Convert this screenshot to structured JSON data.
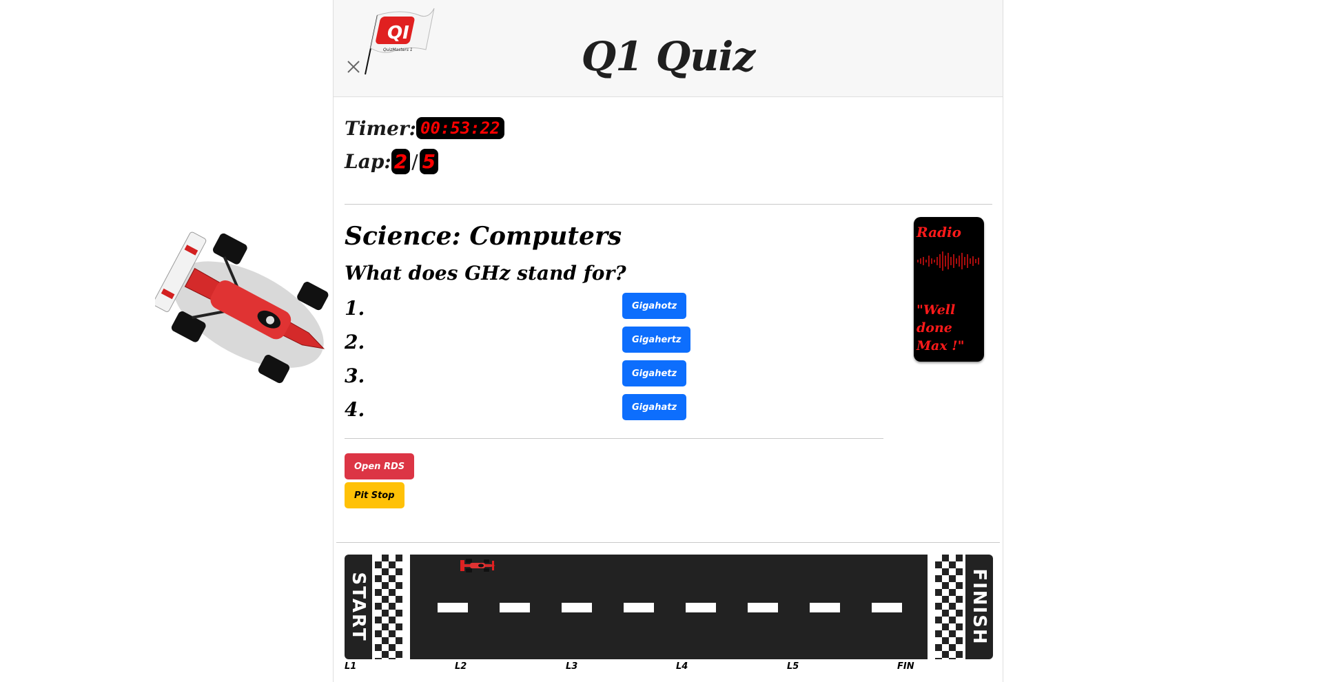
{
  "header": {
    "title": "Q1 Quiz",
    "logo_text": "QI",
    "logo_subtext": "QuizMasters 1"
  },
  "stats": {
    "timer_label": "Timer:",
    "timer_value": "00:53:22",
    "lap_label": "Lap:",
    "lap_current": "2",
    "lap_separator": "/",
    "lap_total": "5"
  },
  "quiz": {
    "category": "Science: Computers",
    "question": "What does GHz stand for?",
    "answers": [
      {
        "number": "1.",
        "label": "Gigahotz"
      },
      {
        "number": "2.",
        "label": "Gigahertz"
      },
      {
        "number": "3.",
        "label": "Gigahetz"
      },
      {
        "number": "4.",
        "label": "Gigahatz"
      }
    ]
  },
  "actions": {
    "rds_label": "Open RDS",
    "pit_label": "Pit Stop"
  },
  "radio": {
    "title": "Radio",
    "message": "\"Well done Max !\""
  },
  "track": {
    "start_label": "START",
    "finish_label": "FINISH",
    "lap_marks": [
      "L1",
      "L2",
      "L3",
      "L4",
      "L5",
      "FIN"
    ],
    "car_progress_lap": 2
  },
  "colors": {
    "primary": "#0d6efd",
    "danger": "#dc3545",
    "warning": "#ffc107",
    "digital_red": "#ff0000",
    "track": "#222222"
  }
}
